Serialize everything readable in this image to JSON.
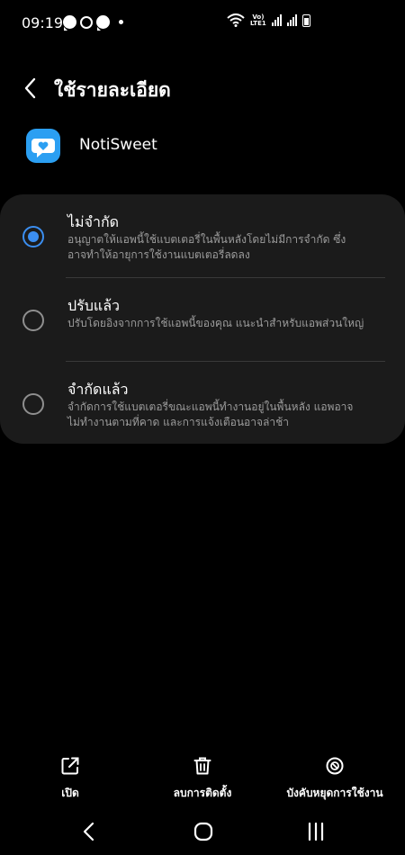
{
  "status_bar": {
    "time": "09:19",
    "left_icons": [
      "messenger-icon",
      "chat-icon",
      "messenger-icon",
      "dot-icon"
    ],
    "volte_text": "Vo)\nLTE1",
    "right_icons": [
      "wifi-icon",
      "signal-icon",
      "signal-icon",
      "battery-icon"
    ]
  },
  "header": {
    "title": "ใช้รายละเอียด",
    "back_icon": "chevron-left-icon"
  },
  "app": {
    "name": "NotiSweet",
    "icon": "noti-sweet-app-icon"
  },
  "options": [
    {
      "title": "ไม่จำกัด",
      "description": "อนุญาตให้แอพนี้ใช้แบตเตอรี่ในพื้นหลังโดยไม่มีการจำกัด ซึ่งอาจทำให้อายุการใช้งานแบตเตอรี่ลดลง",
      "selected": true
    },
    {
      "title": "ปรับแล้ว",
      "description": "ปรับโดยอิงจากการใช้แอพนี้ของคุณ แนะนำสำหรับแอพส่วนใหญ่",
      "selected": false
    },
    {
      "title": "จำกัดแล้ว",
      "description": "จำกัดการใช้แบตเตอรี่ขณะแอพนี้ทำงานอยู่ในพื้นหลัง แอพอาจไม่ทำงานตามที่คาด และการแจ้งเตือนอาจล่าช้า",
      "selected": false
    }
  ],
  "actions": {
    "open": "เปิด",
    "uninstall": "ลบการติดตั้ง",
    "force_stop": "บังคับหยุดการใช้งาน"
  },
  "nav": {
    "back": "back-icon",
    "home": "home-icon",
    "recents": "recents-icon"
  },
  "colors": {
    "accent": "#3b8ef0",
    "card": "#1b1b1b",
    "app_icon": "#2b9ff2"
  }
}
